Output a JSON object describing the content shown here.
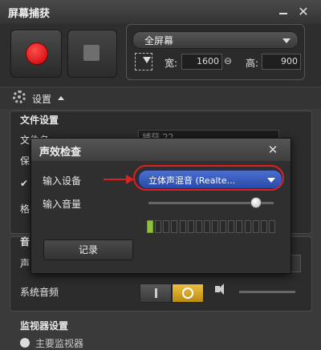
{
  "window": {
    "title": "屏幕捕获"
  },
  "region": {
    "mode": "全屏幕",
    "width_label": "宽:",
    "width": "1600",
    "height_label": "高:",
    "height": "900"
  },
  "settings": {
    "label": "设置"
  },
  "file_settings": {
    "header": "文件设置",
    "file_name_label": "文件名:",
    "file_name_value": "捕获 22",
    "save_label": "保",
    "check_label": "",
    "format_label": "格"
  },
  "audio_settings": {
    "header": "音",
    "mic_label": "声",
    "system_audio_label": "系统音频"
  },
  "monitor_settings": {
    "header": "监视器设置",
    "item_label": "主要监视器"
  },
  "dialog": {
    "title": "声效检查",
    "input_device_label": "输入设备",
    "input_device_value": "立体声混音 (Realte...",
    "input_volume_label": "输入音量",
    "input_volume_level": 0.85,
    "meter_segments": 16,
    "meter_active": 1,
    "record_label": "记录"
  },
  "colors": {
    "accent": "#2b4aa8",
    "highlight": "#e02020",
    "meter_on": "#8fc23a",
    "toggle_on": "#f0c040",
    "record": "#c80000"
  }
}
